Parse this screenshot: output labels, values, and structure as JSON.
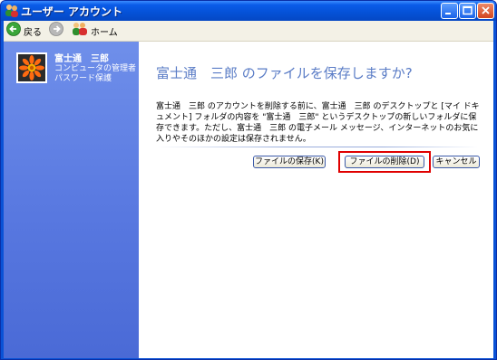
{
  "window": {
    "title": "ユーザー アカウント"
  },
  "toolbar": {
    "back_label": "戻る",
    "home_label": "ホーム"
  },
  "user": {
    "name": "富士通　三郎",
    "role": "コンピュータの管理者",
    "password_status": "パスワード保護"
  },
  "main": {
    "heading": "富士通　三郎 のファイルを保存しますか?",
    "description": "富士通　三郎 のアカウントを削除する前に、富士通　三郎 のデスクトップと [マイ ドキュメント] フォルダの内容を \"富士通　三郎\" というデスクトップの新しいフォルダに保存できます。ただし、富士通　三郎 の電子メール メッセージ、インターネットのお気に入りやそのほかの設定は保存されません。",
    "buttons": {
      "save": "ファイルの保存(K)",
      "delete": "ファイルの削除(D)",
      "cancel": "キャンセル"
    }
  },
  "colors": {
    "titlebar": "#0551d6",
    "leftpane": "#5878e0",
    "heading": "#5a7cc6",
    "highlight": "#e00000"
  }
}
